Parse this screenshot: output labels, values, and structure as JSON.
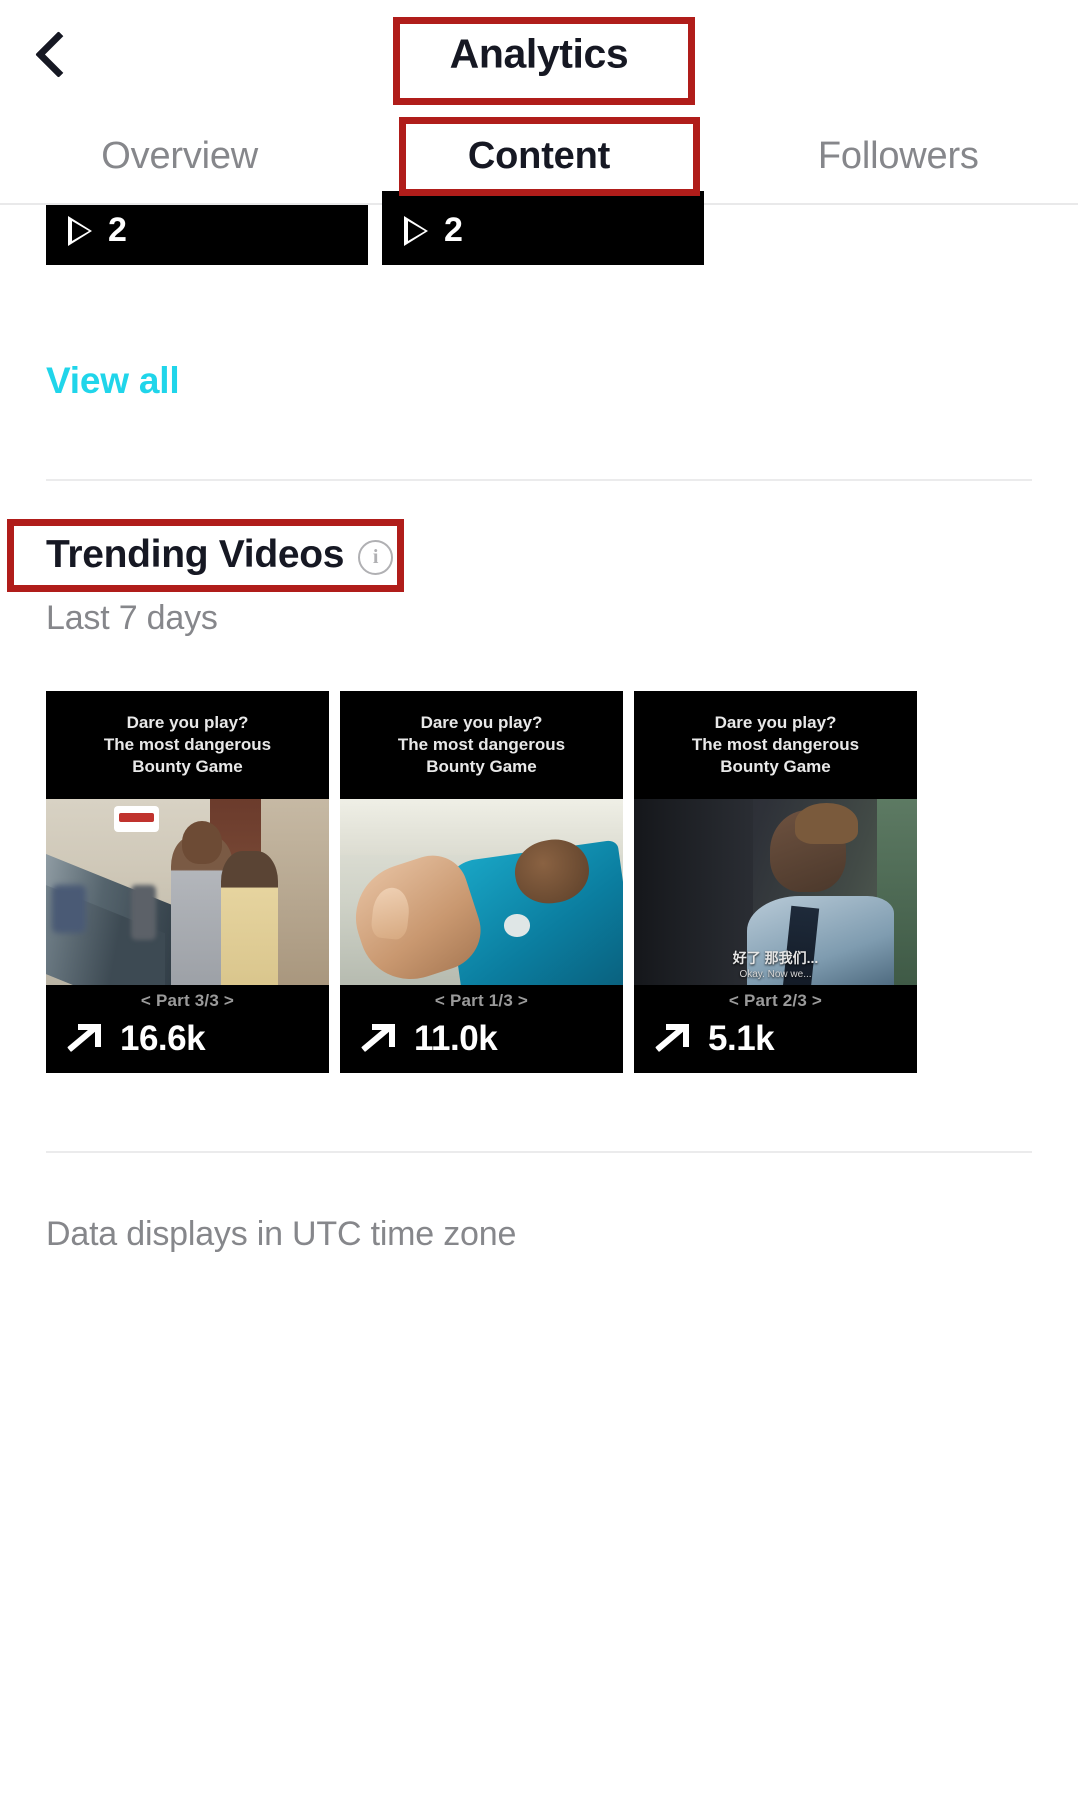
{
  "header": {
    "title": "Analytics",
    "back_icon": "chevron-left-icon"
  },
  "tabs": [
    {
      "label": "Overview",
      "active": false
    },
    {
      "label": "Content",
      "active": true
    },
    {
      "label": "Followers",
      "active": false
    }
  ],
  "top_videos": {
    "cards": [
      {
        "play_icon": "play-icon",
        "views": "2"
      },
      {
        "play_icon": "play-icon",
        "views": "2"
      }
    ],
    "view_all_label": "View all"
  },
  "trending": {
    "title": "Trending Videos",
    "info_icon": "info-icon",
    "info_glyph": "i",
    "subtitle": "Last 7 days",
    "videos": [
      {
        "overlay_line1": "Dare you play?",
        "overlay_line2": "The most dangerous",
        "overlay_line3": "Bounty Game",
        "part_label": "< Part 3/3 >",
        "metric_icon": "trending-arrow-icon",
        "metric_value": "16.6k",
        "subtitle_cn": "",
        "subtitle_en": ""
      },
      {
        "overlay_line1": "Dare you play?",
        "overlay_line2": "The most dangerous",
        "overlay_line3": "Bounty Game",
        "part_label": "< Part 1/3 >",
        "metric_icon": "trending-arrow-icon",
        "metric_value": "11.0k",
        "subtitle_cn": "",
        "subtitle_en": ""
      },
      {
        "overlay_line1": "Dare you play?",
        "overlay_line2": "The most dangerous",
        "overlay_line3": "Bounty Game",
        "part_label": "< Part 2/3 >",
        "metric_icon": "trending-arrow-icon",
        "metric_value": "5.1k",
        "subtitle_cn": "好了 那我们...",
        "subtitle_en": "Okay. Now we..."
      }
    ]
  },
  "footer": {
    "note": "Data displays in UTC time zone"
  },
  "colors": {
    "accent_teal": "#20d5ea",
    "annotation_red": "#b01d1a",
    "text_primary": "#161823",
    "text_secondary": "#86878b"
  }
}
